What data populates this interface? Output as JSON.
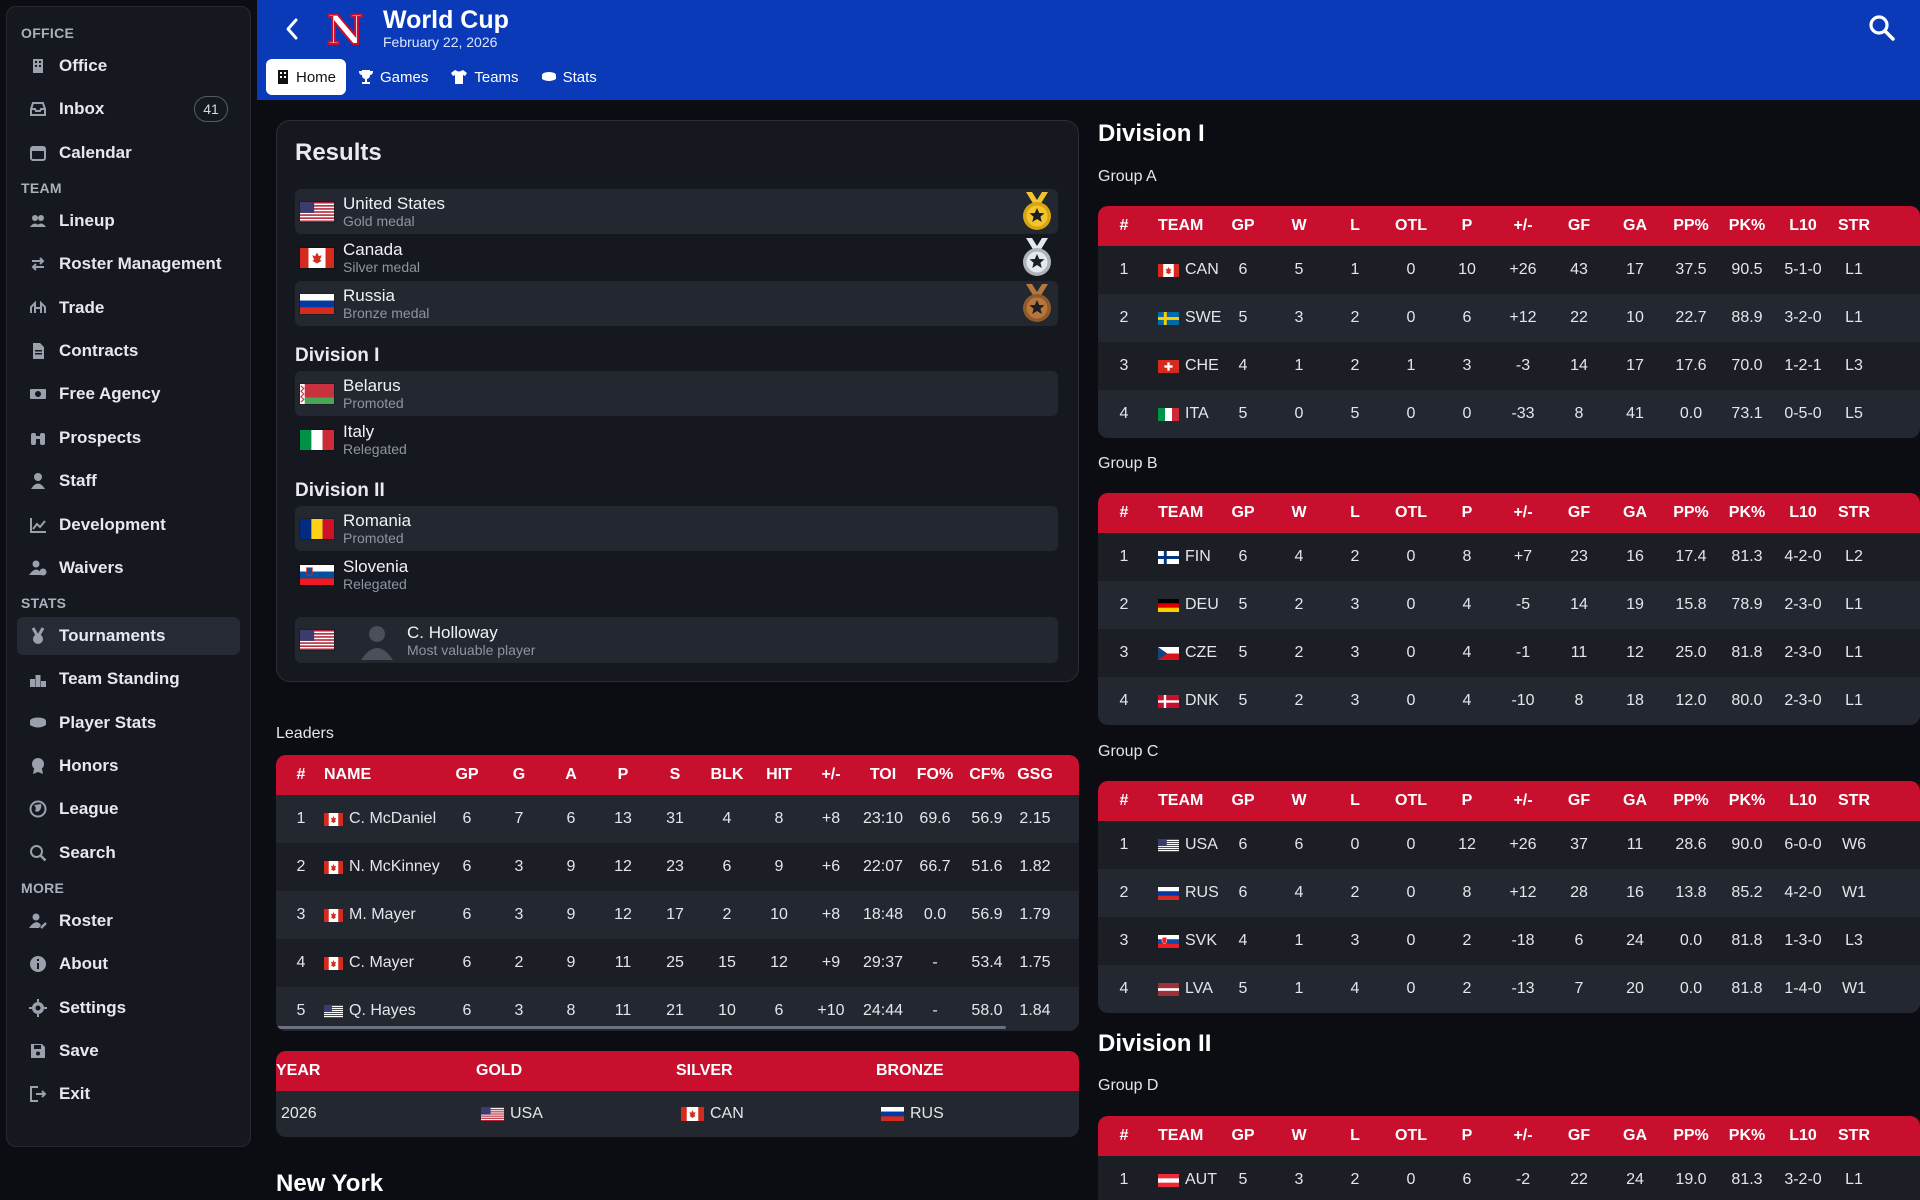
{
  "sidebar": {
    "sections": {
      "office": "OFFICE",
      "team": "TEAM",
      "stats": "STATS",
      "more": "MORE"
    },
    "office_items": [
      {
        "label": "Office",
        "icon": "building-icon"
      },
      {
        "label": "Inbox",
        "icon": "inbox-icon",
        "badge": "41"
      },
      {
        "label": "Calendar",
        "icon": "calendar-icon"
      }
    ],
    "team_items": [
      {
        "label": "Lineup",
        "icon": "users-icon"
      },
      {
        "label": "Roster Management",
        "icon": "swap-icon"
      },
      {
        "label": "Trade",
        "icon": "trade-icon"
      },
      {
        "label": "Contracts",
        "icon": "document-icon"
      },
      {
        "label": "Free Agency",
        "icon": "money-icon"
      },
      {
        "label": "Prospects",
        "icon": "binoculars-icon"
      },
      {
        "label": "Staff",
        "icon": "person-icon"
      },
      {
        "label": "Development",
        "icon": "chart-line-icon"
      },
      {
        "label": "Waivers",
        "icon": "user-clock-icon"
      }
    ],
    "stats_items": [
      {
        "label": "Tournaments",
        "icon": "medal-icon",
        "active": true
      },
      {
        "label": "Team Standing",
        "icon": "podium-icon"
      },
      {
        "label": "Player Stats",
        "icon": "puck-icon"
      },
      {
        "label": "Honors",
        "icon": "award-icon"
      },
      {
        "label": "League",
        "icon": "globe-icon"
      },
      {
        "label": "Search",
        "icon": "search-icon"
      }
    ],
    "more_items": [
      {
        "label": "Roster",
        "icon": "user-edit-icon"
      },
      {
        "label": "About",
        "icon": "info-icon"
      },
      {
        "label": "Settings",
        "icon": "gear-icon"
      },
      {
        "label": "Save",
        "icon": "floppy-icon"
      },
      {
        "label": "Exit",
        "icon": "exit-icon"
      }
    ]
  },
  "header": {
    "title": "World Cup",
    "date": "February 22, 2026",
    "logo_letter": "N",
    "accent": "#0a3ab8",
    "tabs": [
      {
        "label": "Home",
        "icon": "building-icon",
        "active": true
      },
      {
        "label": "Games",
        "icon": "trophy-icon"
      },
      {
        "label": "Teams",
        "icon": "jersey-icon"
      },
      {
        "label": "Stats",
        "icon": "puck-icon"
      }
    ]
  },
  "results": {
    "title": "Results",
    "medals": [
      {
        "team": "United States",
        "note": "Gold medal",
        "flag": "usa",
        "medal": "gold"
      },
      {
        "team": "Canada",
        "note": "Silver medal",
        "flag": "can",
        "medal": "silver"
      },
      {
        "team": "Russia",
        "note": "Bronze medal",
        "flag": "rus",
        "medal": "bronze"
      }
    ],
    "division1_title": "Division I",
    "division1": [
      {
        "team": "Belarus",
        "note": "Promoted",
        "flag": "blr"
      },
      {
        "team": "Italy",
        "note": "Relegated",
        "flag": "ita"
      }
    ],
    "division2_title": "Division II",
    "division2": [
      {
        "team": "Romania",
        "note": "Promoted",
        "flag": "rou"
      },
      {
        "team": "Slovenia",
        "note": "Relegated",
        "flag": "svn"
      }
    ],
    "mvp": {
      "name": "C. Holloway",
      "note": "Most valuable player",
      "flag": "usa"
    }
  },
  "leaders": {
    "label": "Leaders",
    "columns": [
      "#",
      "NAME",
      "GP",
      "G",
      "A",
      "P",
      "S",
      "BLK",
      "HIT",
      "+/-",
      "TOI",
      "FO%",
      "CF%",
      "GSG"
    ],
    "rows": [
      [
        "1",
        "C. McDaniel",
        "6",
        "7",
        "6",
        "13",
        "31",
        "4",
        "8",
        "+8",
        "23:10",
        "69.6",
        "56.9",
        "2.15"
      ],
      [
        "2",
        "N. McKinney",
        "6",
        "3",
        "9",
        "12",
        "23",
        "6",
        "9",
        "+6",
        "22:07",
        "66.7",
        "51.6",
        "1.82"
      ],
      [
        "3",
        "M. Mayer",
        "6",
        "3",
        "9",
        "12",
        "17",
        "2",
        "10",
        "+8",
        "18:48",
        "0.0",
        "56.9",
        "1.79"
      ],
      [
        "4",
        "C. Mayer",
        "6",
        "2",
        "9",
        "11",
        "25",
        "15",
        "12",
        "+9",
        "29:37",
        "-",
        "53.4",
        "1.75"
      ],
      [
        "5",
        "Q. Hayes",
        "6",
        "3",
        "8",
        "11",
        "21",
        "10",
        "6",
        "+10",
        "24:44",
        "-",
        "58.0",
        "1.84"
      ]
    ],
    "flags": [
      "can",
      "can",
      "can",
      "can",
      "usa"
    ]
  },
  "history": {
    "columns": [
      "YEAR",
      "GOLD",
      "SILVER",
      "BRONZE"
    ],
    "rows": [
      {
        "year": "2026",
        "gold": "USA",
        "silver": "CAN",
        "bronze": "RUS"
      }
    ]
  },
  "next_section": "New York",
  "divisions": {
    "division1_title": "Division I",
    "division2_title": "Division II",
    "columns": [
      "#",
      "TEAM",
      "GP",
      "W",
      "L",
      "OTL",
      "P",
      "+/-",
      "GF",
      "GA",
      "PP%",
      "PK%",
      "L10",
      "STR"
    ],
    "groups": [
      {
        "label": "Group A",
        "rows": [
          {
            "flag": "can",
            "cells": [
              "1",
              "CAN",
              "6",
              "5",
              "1",
              "0",
              "10",
              "+26",
              "43",
              "17",
              "37.5",
              "90.5",
              "5-1-0",
              "L1"
            ]
          },
          {
            "flag": "swe",
            "cells": [
              "2",
              "SWE",
              "5",
              "3",
              "2",
              "0",
              "6",
              "+12",
              "22",
              "10",
              "22.7",
              "88.9",
              "3-2-0",
              "L1"
            ]
          },
          {
            "flag": "che",
            "cells": [
              "3",
              "CHE",
              "4",
              "1",
              "2",
              "1",
              "3",
              "-3",
              "14",
              "17",
              "17.6",
              "70.0",
              "1-2-1",
              "L3"
            ]
          },
          {
            "flag": "ita",
            "cells": [
              "4",
              "ITA",
              "5",
              "0",
              "5",
              "0",
              "0",
              "-33",
              "8",
              "41",
              "0.0",
              "73.1",
              "0-5-0",
              "L5"
            ]
          }
        ]
      },
      {
        "label": "Group B",
        "rows": [
          {
            "flag": "fin",
            "cells": [
              "1",
              "FIN",
              "6",
              "4",
              "2",
              "0",
              "8",
              "+7",
              "23",
              "16",
              "17.4",
              "81.3",
              "4-2-0",
              "L2"
            ]
          },
          {
            "flag": "deu",
            "cells": [
              "2",
              "DEU",
              "5",
              "2",
              "3",
              "0",
              "4",
              "-5",
              "14",
              "19",
              "15.8",
              "78.9",
              "2-3-0",
              "L1"
            ]
          },
          {
            "flag": "cze",
            "cells": [
              "3",
              "CZE",
              "5",
              "2",
              "3",
              "0",
              "4",
              "-1",
              "11",
              "12",
              "25.0",
              "81.8",
              "2-3-0",
              "L1"
            ]
          },
          {
            "flag": "dnk",
            "cells": [
              "4",
              "DNK",
              "5",
              "2",
              "3",
              "0",
              "4",
              "-10",
              "8",
              "18",
              "12.0",
              "80.0",
              "2-3-0",
              "L1"
            ]
          }
        ]
      },
      {
        "label": "Group C",
        "rows": [
          {
            "flag": "usa",
            "cells": [
              "1",
              "USA",
              "6",
              "6",
              "0",
              "0",
              "12",
              "+26",
              "37",
              "11",
              "28.6",
              "90.0",
              "6-0-0",
              "W6"
            ]
          },
          {
            "flag": "rus",
            "cells": [
              "2",
              "RUS",
              "6",
              "4",
              "2",
              "0",
              "8",
              "+12",
              "28",
              "16",
              "13.8",
              "85.2",
              "4-2-0",
              "W1"
            ]
          },
          {
            "flag": "svk",
            "cells": [
              "3",
              "SVK",
              "4",
              "1",
              "3",
              "0",
              "2",
              "-18",
              "6",
              "24",
              "0.0",
              "81.8",
              "1-3-0",
              "L3"
            ]
          },
          {
            "flag": "lva",
            "cells": [
              "4",
              "LVA",
              "5",
              "1",
              "4",
              "0",
              "2",
              "-13",
              "7",
              "20",
              "0.0",
              "81.8",
              "1-4-0",
              "W1"
            ]
          }
        ]
      },
      {
        "label": "Group D",
        "rows": [
          {
            "flag": "aut",
            "cells": [
              "1",
              "AUT",
              "5",
              "3",
              "2",
              "0",
              "6",
              "-2",
              "22",
              "24",
              "19.0",
              "81.3",
              "3-2-0",
              "L1"
            ]
          }
        ]
      }
    ]
  }
}
